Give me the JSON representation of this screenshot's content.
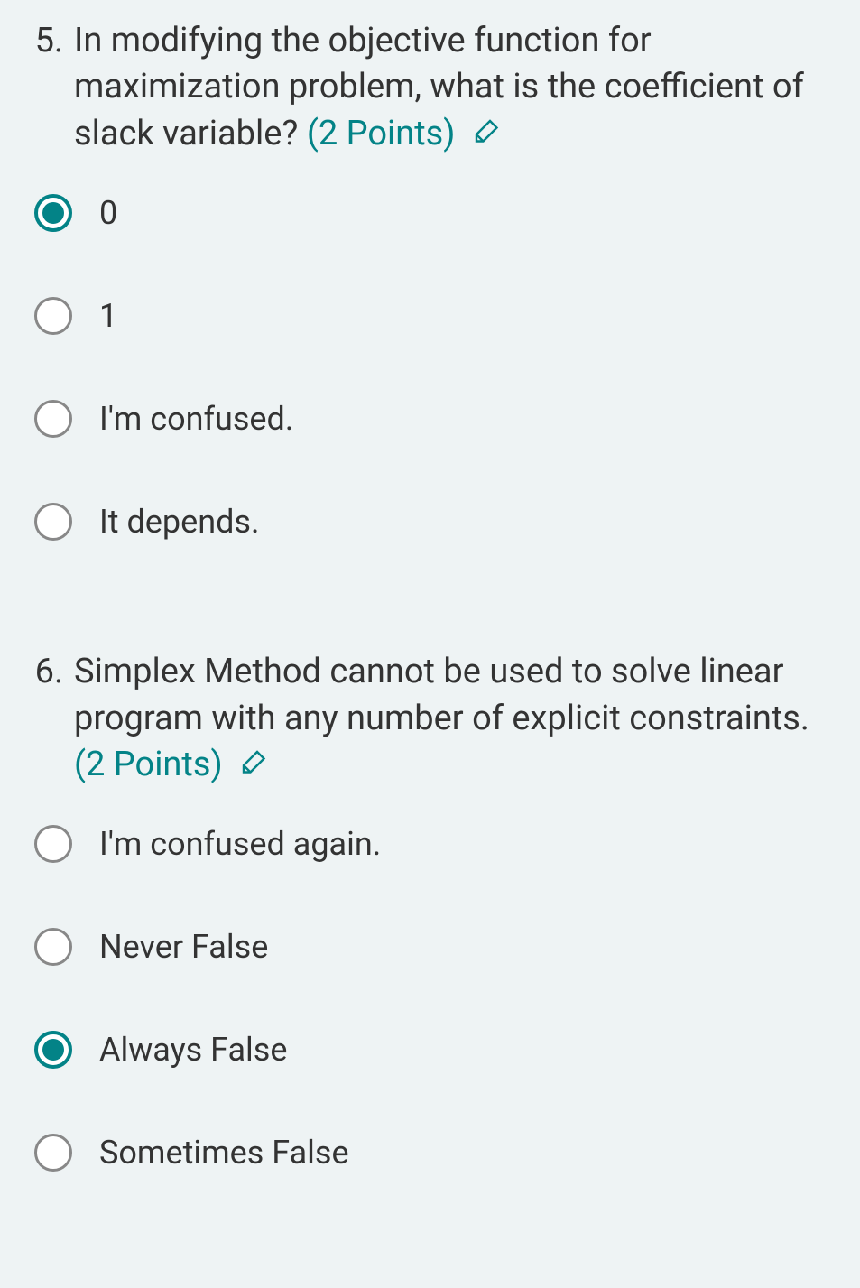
{
  "questions": [
    {
      "number": "5.",
      "text": "In modifying the objective function for maximization problem, what is the coefficient of slack variable?",
      "points": "(2 Points)",
      "options": [
        {
          "label": "0",
          "selected": true
        },
        {
          "label": "1",
          "selected": false
        },
        {
          "label": "I'm confused.",
          "selected": false
        },
        {
          "label": "It depends.",
          "selected": false
        }
      ]
    },
    {
      "number": "6.",
      "text": "Simplex Method cannot be used to solve linear program with any number of explicit constraints.",
      "points": "(2 Points)",
      "options": [
        {
          "label": "I'm confused again.",
          "selected": false
        },
        {
          "label": "Never False",
          "selected": false
        },
        {
          "label": "Always False",
          "selected": true
        },
        {
          "label": "Sometimes False",
          "selected": false
        }
      ]
    }
  ],
  "colors": {
    "accent": "#038387",
    "background": "#eef3f4"
  }
}
